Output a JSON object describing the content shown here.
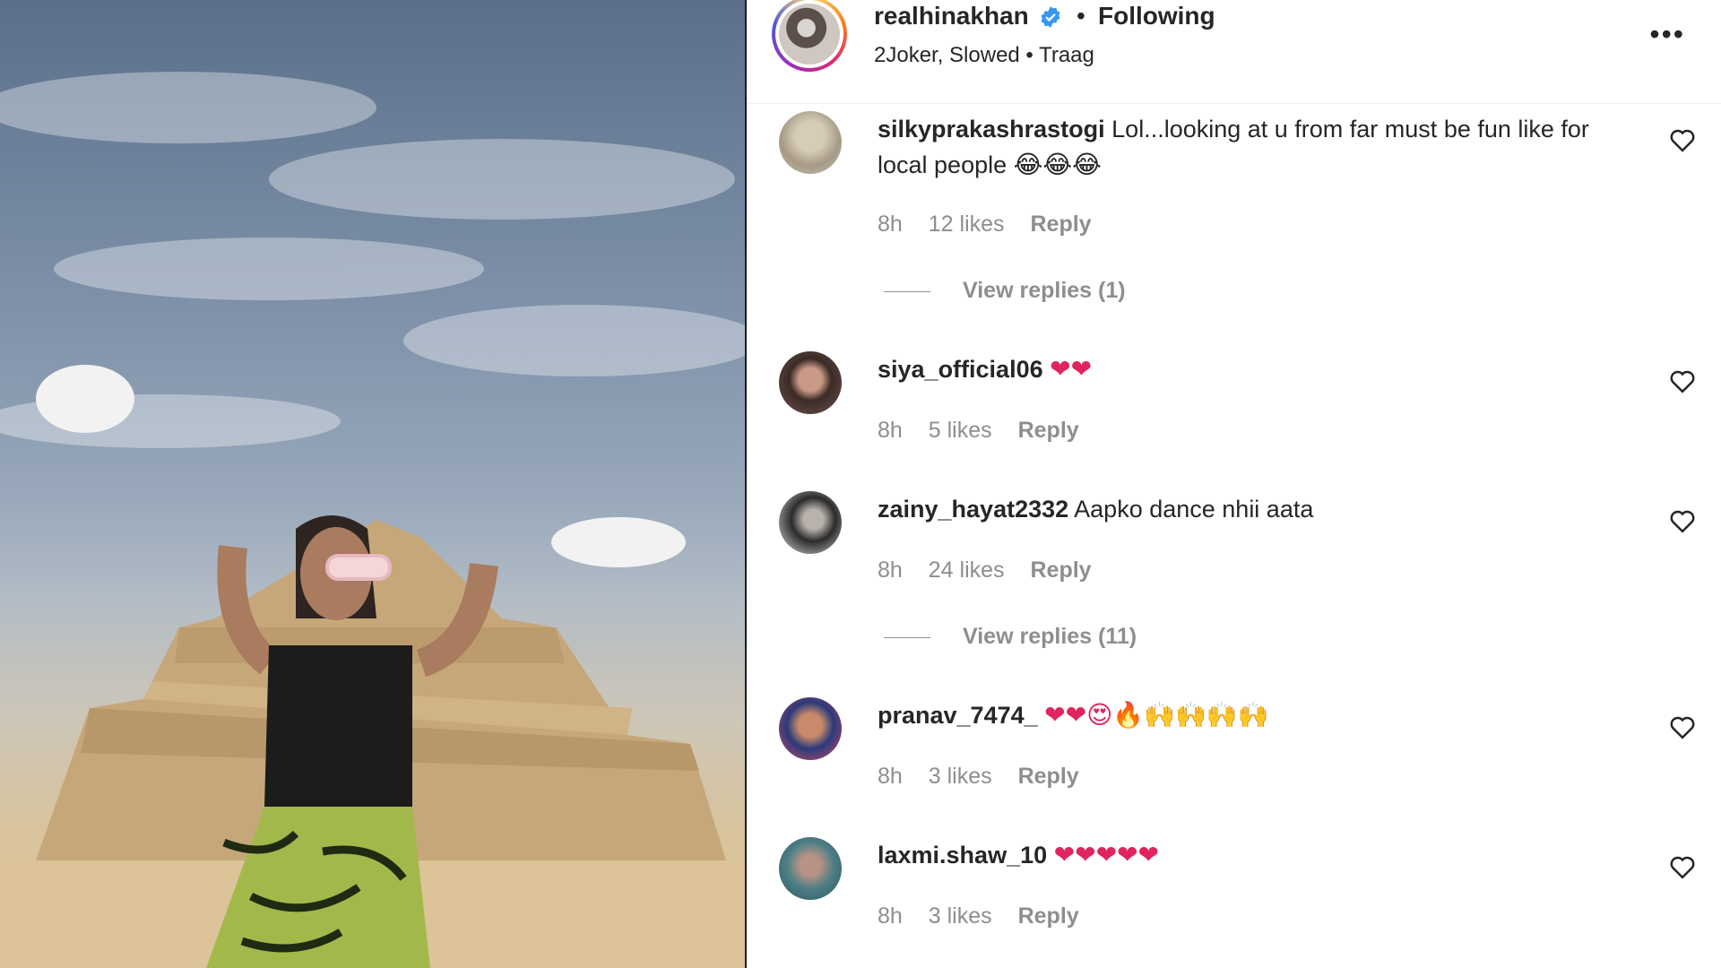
{
  "post": {
    "username": "realhinakhan",
    "separator": "•",
    "follow_status": "Following",
    "audio": "2Joker, Slowed • Traag",
    "more_icon": "more-horizontal-icon",
    "verified_icon": "verified-badge-icon",
    "verified_color": "#3897f0"
  },
  "comments": [
    {
      "username": "silkyprakashrastogi",
      "text": "Lol...looking at u from far must be fun like for local people",
      "emoji": "😂😂😂",
      "time": "8h",
      "likes": "12 likes",
      "reply": "Reply",
      "view_replies": "View replies (1)"
    },
    {
      "username": "siya_official06",
      "text": "",
      "emoji": "❤❤",
      "time": "8h",
      "likes": "5 likes",
      "reply": "Reply"
    },
    {
      "username": "zainy_hayat2332",
      "text": "Aapko dance nhii aata",
      "emoji": "",
      "time": "8h",
      "likes": "24 likes",
      "reply": "Reply",
      "view_replies": "View replies (11)"
    },
    {
      "username": "pranav_7474_",
      "text": "",
      "emoji": "❤❤😍🔥🙌🙌🙌🙌",
      "time": "8h",
      "likes": "3 likes",
      "reply": "Reply"
    },
    {
      "username": "laxmi.shaw_10",
      "text": "",
      "emoji": "❤❤❤❤❤",
      "time": "8h",
      "likes": "3 likes",
      "reply": "Reply"
    }
  ],
  "colors": {
    "like_heart": "#262626",
    "meta_gray": "#8e8e8e",
    "heart_emoji": "#e0245e"
  }
}
